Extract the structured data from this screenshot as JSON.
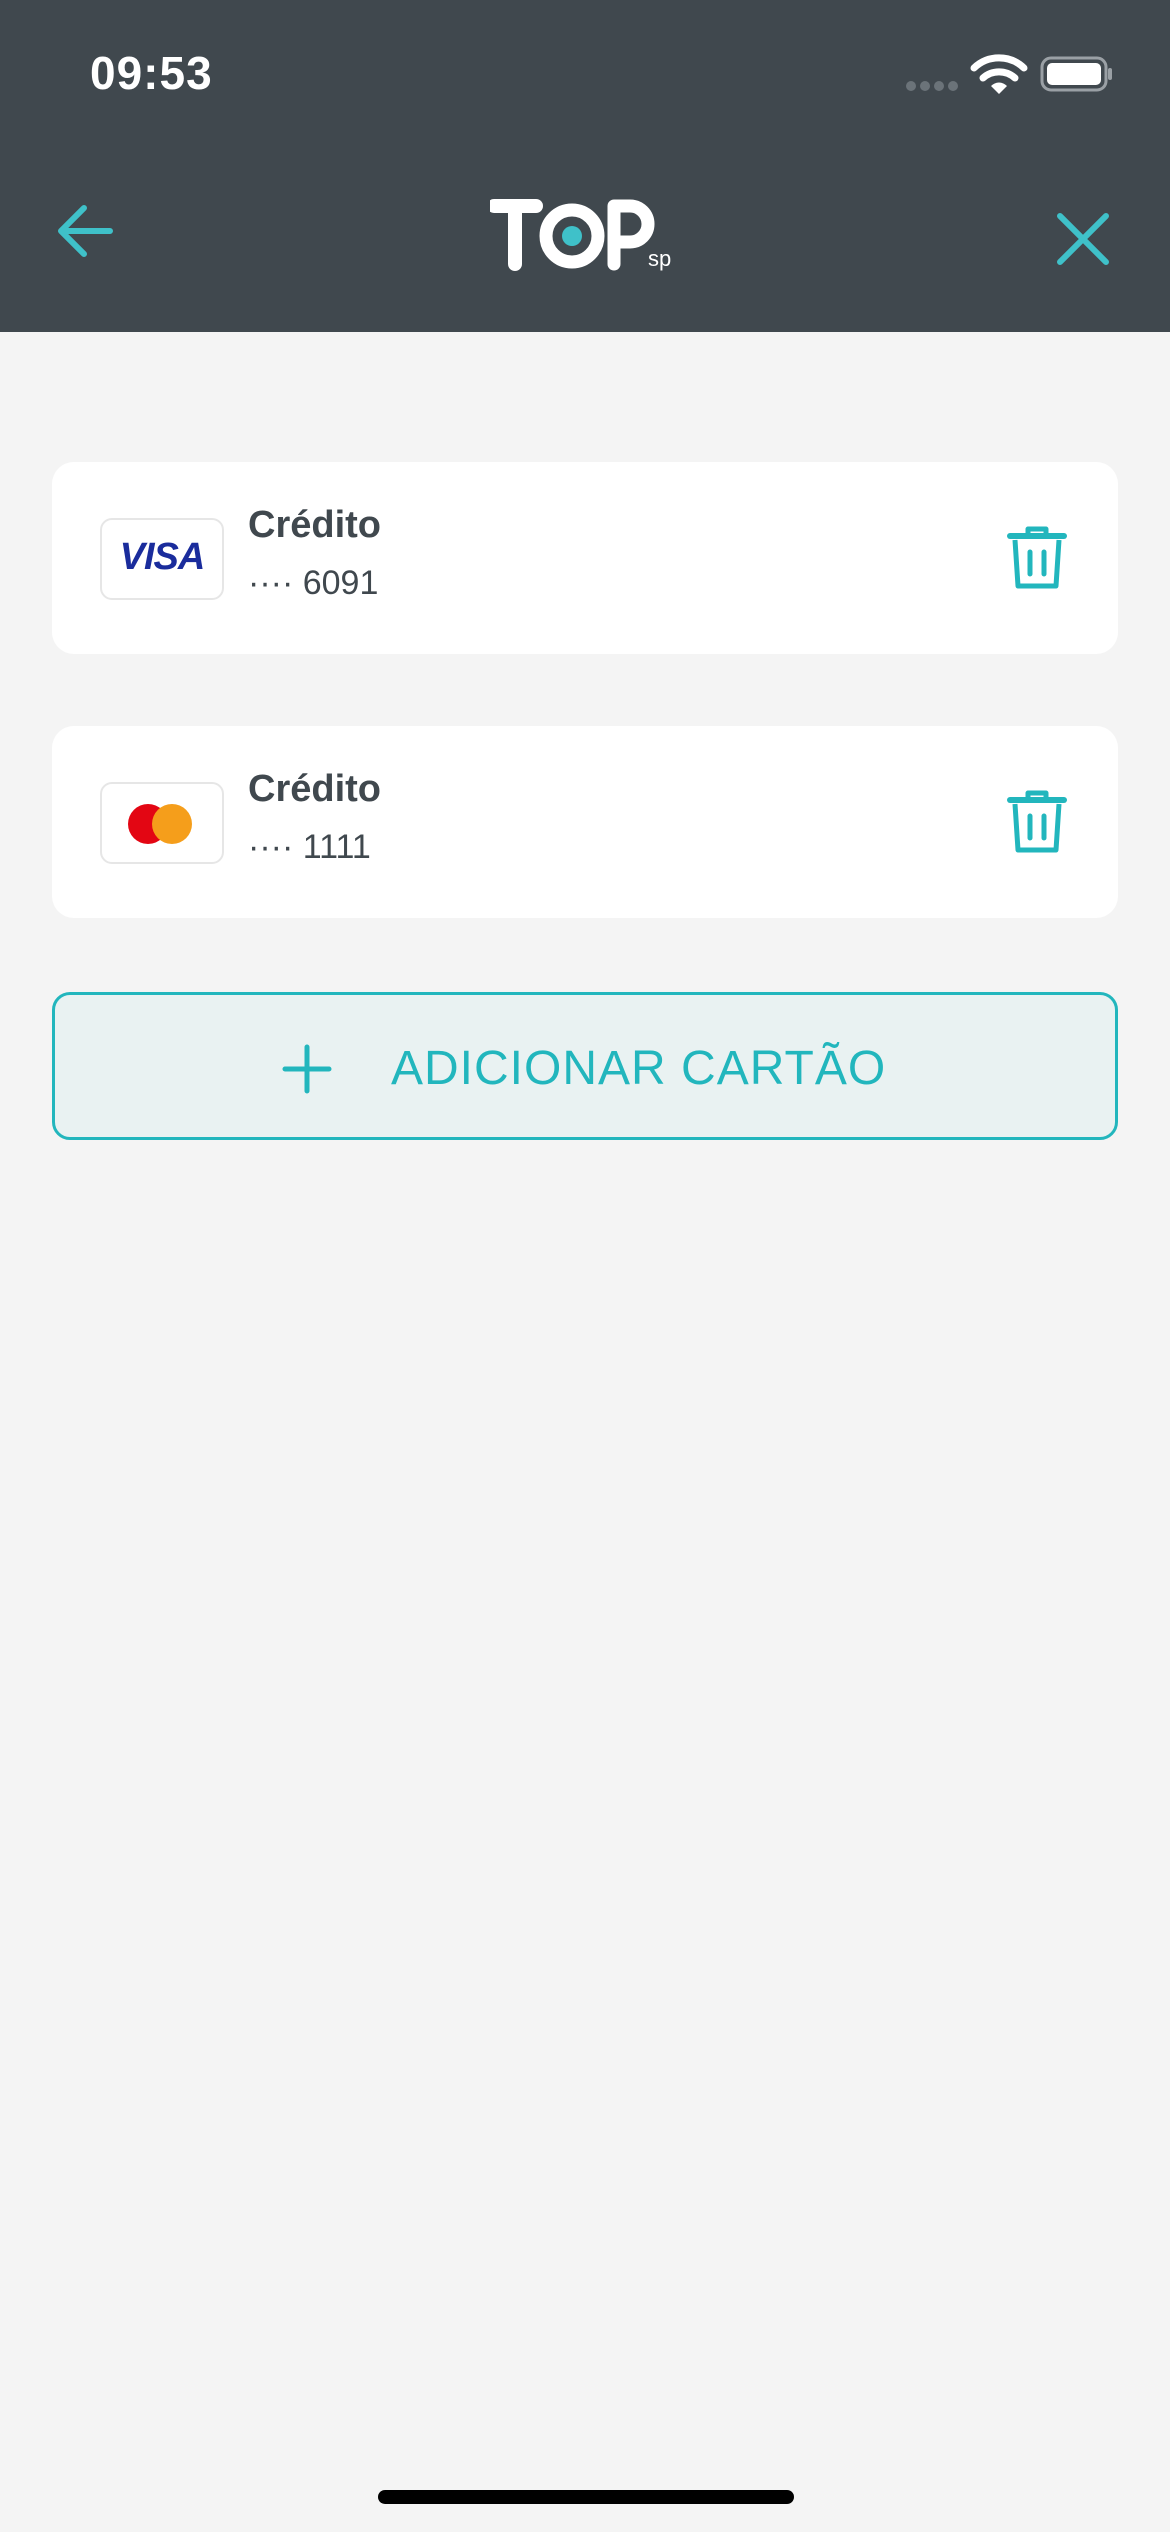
{
  "status_bar": {
    "time": "09:53"
  },
  "header": {
    "logo_text": "TOP",
    "logo_sub": "sp",
    "back_icon": "arrow-left-icon",
    "close_icon": "close-icon",
    "accent_color": "#3fc1c9",
    "background_color": "#40484e"
  },
  "cards": [
    {
      "brand": "VISA",
      "brand_icon": "visa-logo",
      "type": "Crédito",
      "number": "···· 6091",
      "delete_icon": "trash-icon"
    },
    {
      "brand": "Mastercard",
      "brand_icon": "mastercard-logo",
      "type": "Crédito",
      "number": "···· 1111",
      "delete_icon": "trash-icon"
    }
  ],
  "add_card": {
    "icon": "plus-icon",
    "label": "ADICIONAR CARTÃO",
    "color": "#22b6bd"
  }
}
